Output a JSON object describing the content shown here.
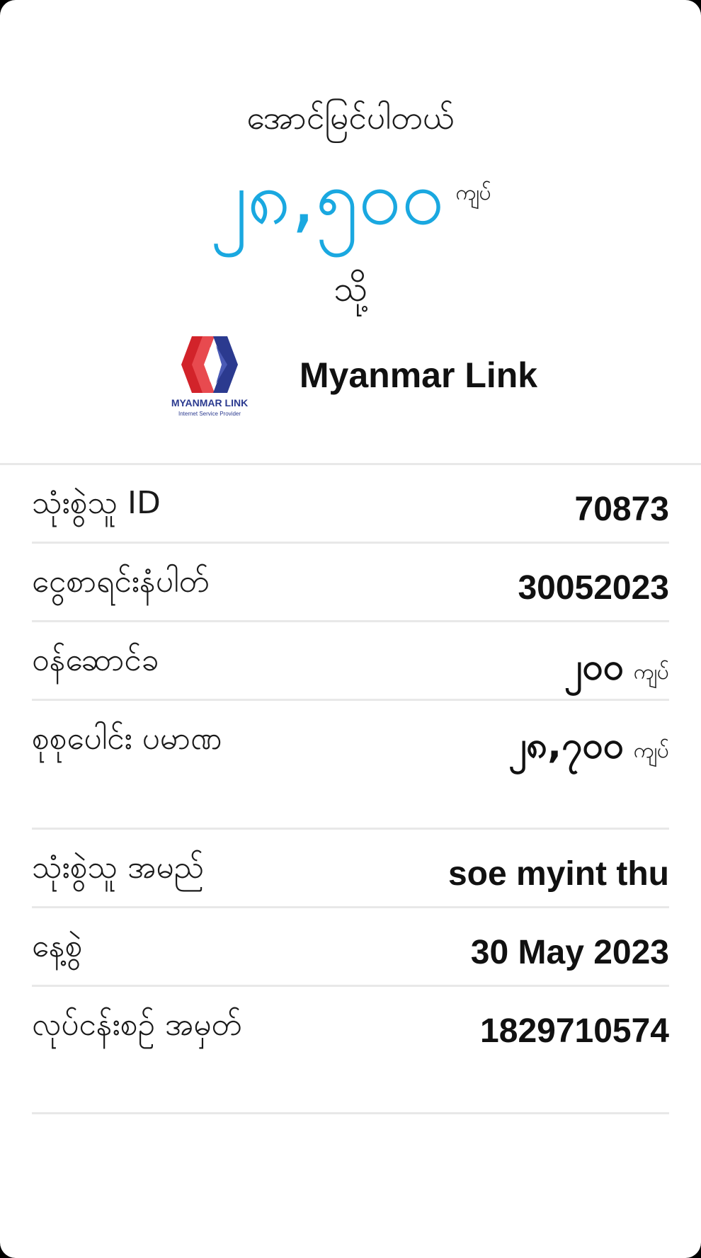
{
  "receipt": {
    "status_title": "အောင်မြင်ပါတယ်",
    "amount": "၂၈,၅၀၀",
    "amount_unit": "ကျပ်",
    "to_label": "သို့",
    "biller_name": "Myanmar Link",
    "logo_text": "MYANMAR LINK",
    "logo_subtext": "Internet Service Provider"
  },
  "colors": {
    "accent": "#1aa8e0",
    "logo_red": "#d2232a",
    "logo_blue": "#2b3a8f",
    "divider": "#e8e8e8"
  },
  "details": [
    {
      "label": "သုံးစွဲသူ ID",
      "value": "70873"
    },
    {
      "label": "ငွေစာရင်းနံပါတ်",
      "value": "30052023"
    },
    {
      "label": "ဝန်ဆောင်ခ",
      "value": "၂၀၀",
      "unit": "ကျပ်"
    },
    {
      "label": "စုစုပေါင်း ပမာဏ",
      "value": "၂၈,၇၀၀",
      "unit": "ကျပ်"
    },
    {
      "label": "သုံးစွဲသူ အမည်",
      "value": "soe myint thu"
    },
    {
      "label": "နေ့စွဲ",
      "value": "30 May 2023"
    },
    {
      "label": "လုပ်ငန်းစဉ် အမှတ်",
      "value": "1829710574"
    }
  ]
}
